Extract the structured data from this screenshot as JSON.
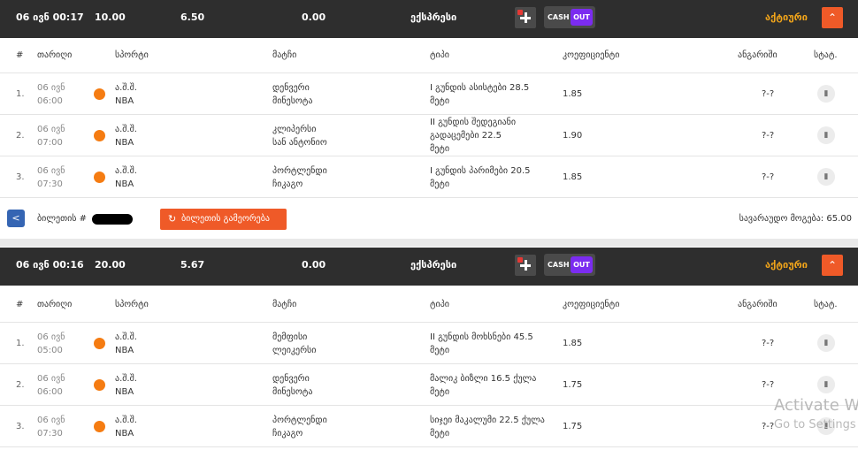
{
  "columns": {
    "num": "#",
    "date": "თარიღი",
    "sport": "სპორტი",
    "match": "მატჩი",
    "type": "ტიპი",
    "odds": "კოეფიციენტი",
    "result": "ანგარიში",
    "stat": "სტატ."
  },
  "tickets": [
    {
      "header": {
        "datetime": "06 ივნ 00:17",
        "stake": "10.00",
        "total_odds": "6.50",
        "payout": "0.00",
        "bet_type": "ექსპრესი",
        "cash_label": "CASH",
        "out_label": "OUT",
        "status": "აქტიური"
      },
      "rows": [
        {
          "num": "1.",
          "date": "06 ივნ",
          "time": "06:00",
          "country": "ა.შ.შ.",
          "league": "NBA",
          "team1": "დენვერი",
          "team2": "მინესოტა",
          "type_lines": [
            "I გუნდის ასისტები 28.5",
            "მეტი"
          ],
          "odds": "1.85",
          "result": "?-?"
        },
        {
          "num": "2.",
          "date": "06 ივნ",
          "time": "07:00",
          "country": "ა.შ.შ.",
          "league": "NBA",
          "team1": "კლიპერსი",
          "team2": "სან ანტონიო",
          "type_lines": [
            "II გუნდის შედეგიანი",
            "გადაცემები 22.5",
            "მეტი"
          ],
          "odds": "1.90",
          "result": "?-?"
        },
        {
          "num": "3.",
          "date": "06 ივნ",
          "time": "07:30",
          "country": "ა.შ.შ.",
          "league": "NBA",
          "team1": "პორტლენდი",
          "team2": "ჩიკაგო",
          "type_lines": [
            "I გუნდის პარიმები 20.5",
            "მეტი"
          ],
          "odds": "1.85",
          "result": "?-?"
        }
      ],
      "footer": {
        "ticket_label": "ბილეთის #",
        "repeat_label": "ბილეთის გამეორება",
        "estimated": "სავარაუდო მოგება: 65.00"
      }
    },
    {
      "header": {
        "datetime": "06 ივნ 00:16",
        "stake": "20.00",
        "total_odds": "5.67",
        "payout": "0.00",
        "bet_type": "ექსპრესი",
        "cash_label": "CASH",
        "out_label": "OUT",
        "status": "აქტიური"
      },
      "rows": [
        {
          "num": "1.",
          "date": "06 ივნ",
          "time": "05:00",
          "country": "ა.შ.შ.",
          "league": "NBA",
          "team1": "მემფისი",
          "team2": "ლეიკერსი",
          "type_lines": [
            "II გუნდის მოხსნები 45.5",
            "მეტი"
          ],
          "odds": "1.85",
          "result": "?-?"
        },
        {
          "num": "2.",
          "date": "06 ივნ",
          "time": "06:00",
          "country": "ა.შ.შ.",
          "league": "NBA",
          "team1": "დენვერი",
          "team2": "მინესოტა",
          "type_lines": [
            "მალიკ ბიზლი 16.5 ქულა",
            "მეტი"
          ],
          "odds": "1.75",
          "result": "?-?"
        },
        {
          "num": "3.",
          "date": "06 ივნ",
          "time": "07:30",
          "country": "ა.შ.შ.",
          "league": "NBA",
          "team1": "პორტლენდი",
          "team2": "ჩიკაგო",
          "type_lines": [
            "სიჯეი მაკალუმი 22.5 ქულა",
            "მეტი"
          ],
          "odds": "1.75",
          "result": "?-?"
        }
      ]
    }
  ],
  "watermark": {
    "line1": "Activate W",
    "line2": "Go to Settings"
  }
}
